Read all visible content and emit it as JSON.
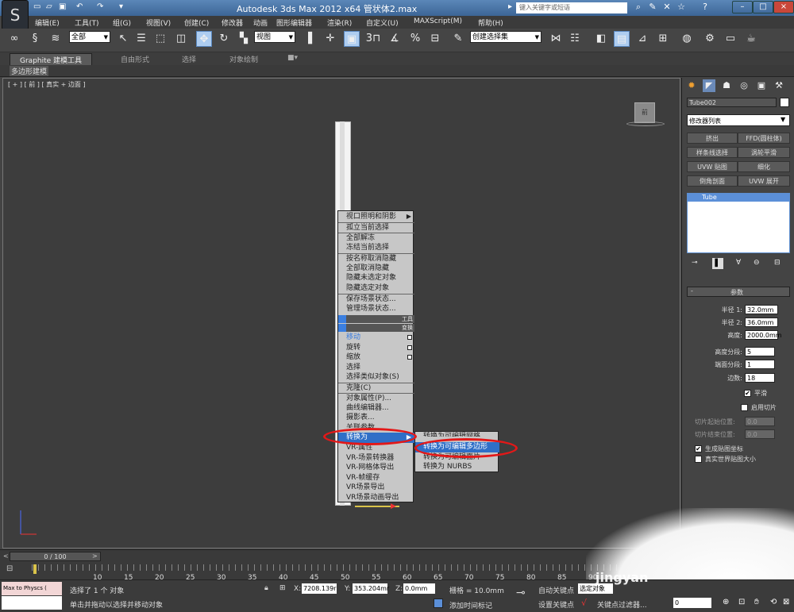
{
  "title": {
    "app": "Autodesk 3ds Max  2012 x64",
    "file": "管状体2.max",
    "search_placeholder": "键入关键字或短语"
  },
  "menu": [
    "编辑(E)",
    "工具(T)",
    "组(G)",
    "视图(V)",
    "创建(C)",
    "修改器",
    "动画",
    "图形编辑器",
    "渲染(R)",
    "自定义(U)",
    "MAXScript(M)",
    "帮助(H)"
  ],
  "toolbar": {
    "filter": "全部",
    "ref_coord": "视图",
    "selection_set": "创建选择集",
    "snap3": "3",
    "snap25": "2.5"
  },
  "ribbon": {
    "tabs": [
      "Graphite 建模工具",
      "自由形式",
      "选择",
      "对象绘制"
    ],
    "sub": "多边形建模"
  },
  "viewport": {
    "label": "[ + ] [ 前 ] [ 真实 + 边面 ]",
    "viewcube": "前"
  },
  "quad_menu": {
    "items": [
      "视口照明和阴影",
      "孤立当前选择",
      "全部解冻",
      "冻结当前选择",
      "按名称取消隐藏",
      "全部取消隐藏",
      "隐藏未选定对象",
      "隐藏选定对象",
      "保存场景状态...",
      "管理场景状态..."
    ],
    "bars": [
      "工具",
      "变换"
    ],
    "items2": [
      "移动",
      "旋转",
      "缩放",
      "选择",
      "选择类似对象(S)",
      "克隆(C)",
      "对象属性(P)...",
      "曲线编辑器...",
      "摄影表...",
      "关联参数",
      "转换为",
      "VR-属性",
      "VR-场景转换器",
      "VR-网格体导出",
      "VR-帧缓存",
      "VR场景导出",
      "VR场景动画导出"
    ],
    "submenu": [
      "转换为可编辑网格",
      "转换为可编辑多边形",
      "转换为可编辑面片",
      "转换为 NURBS"
    ]
  },
  "rpanel": {
    "object_name": "Tube002",
    "modifier_list": "修改器列表",
    "buttons": [
      "挤出",
      "FFD(圆柱体)",
      "样条线选择",
      "涡轮平滑",
      "UVW 贴图",
      "细化",
      "倒角剖面",
      "UVW 展开"
    ],
    "stack": "Tube",
    "rollout": "参数",
    "params": [
      {
        "label": "半径 1:",
        "value": "32.0mm"
      },
      {
        "label": "半径 2:",
        "value": "36.0mm"
      },
      {
        "label": "高度:",
        "value": "2000.0mm"
      },
      {
        "label": "高度分段:",
        "value": "5"
      },
      {
        "label": "端面分段:",
        "value": "1"
      },
      {
        "label": "边数:",
        "value": "18"
      }
    ],
    "smooth": "平滑",
    "slice_on": "启用切片",
    "slice_from": "切片起始位置:",
    "slice_to": "切片结束位置:",
    "slice_from_value": "0.0",
    "slice_to_value": "0.0",
    "gen_map": "生成贴图坐标",
    "real_world": "真实世界贴图大小"
  },
  "timeline": {
    "slider": "0 / 100",
    "ticks": [
      "10",
      "15",
      "20",
      "25",
      "30",
      "35",
      "40",
      "45",
      "50",
      "55",
      "60",
      "65",
      "70",
      "75",
      "80",
      "85",
      "90"
    ]
  },
  "status": {
    "maxscript": "Max to Physcs (",
    "selected": "选择了 1 个 对象",
    "prompt": "单击并拖动以选择并移动对象",
    "x": "7208.139r",
    "y": "353.204mr",
    "z": "0.0mm",
    "grid": "栅格 = 10.0mm",
    "add_time_tag": "添加时间标记",
    "auto_key": "自动关键点",
    "set_key": "设置关键点",
    "selected_obj": "选定对象",
    "key_filter": "关键点过滤器...",
    "frame": "0"
  },
  "watermark": "jingyan"
}
